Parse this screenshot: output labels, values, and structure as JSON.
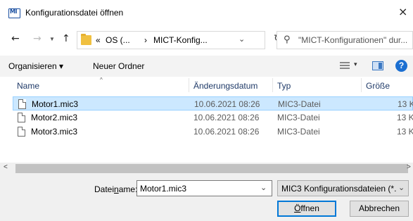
{
  "window": {
    "app_icon_text": "MI",
    "title": "Konfigurationsdatei öffnen",
    "close_glyph": "×"
  },
  "nav": {
    "back_glyph": "←",
    "forward_glyph": "→",
    "recent_glyph": "⌄",
    "up_glyph": "↑",
    "breadcrumb": [
      "«",
      "OS (...",
      "›",
      "MICT-Konfig..."
    ],
    "address_dropdown_glyph": "⌄",
    "refresh_glyph": "↻",
    "search_icon": "search-icon",
    "search_placeholder": "\"MICT-Konfigurationen\" dur..."
  },
  "toolbar": {
    "organize_label": "Organisieren ▾",
    "new_folder_label": "Neuer Ordner",
    "view_dropdown_glyph": "▾",
    "help_glyph": "?"
  },
  "columns": {
    "name": "Name",
    "date": "Änderungsdatum",
    "type": "Typ",
    "size": "Größe",
    "sort_indicator": "^"
  },
  "files": [
    {
      "name": "Motor1.mic3",
      "date": "10.06.2021 08:26",
      "type": "MIC3-Datei",
      "size": "13 K",
      "selected": true
    },
    {
      "name": "Motor2.mic3",
      "date": "10.06.2021 08:26",
      "type": "MIC3-Datei",
      "size": "13 K",
      "selected": false
    },
    {
      "name": "Motor3.mic3",
      "date": "10.06.2021 08:26",
      "type": "MIC3-Datei",
      "size": "13 K",
      "selected": false
    }
  ],
  "scrollbar": {
    "left_glyph": "<",
    "right_glyph": ">"
  },
  "footer": {
    "filename_label_pre": "Datei",
    "filename_label_u": "n",
    "filename_label_post": "ame:",
    "filename_value": "Motor1.mic3",
    "filename_dropdown_glyph": "⌄",
    "filetype_value": "MIC3 Konfigurationsdateien (*.",
    "filetype_dropdown_glyph": "⌄",
    "open_u": "Ö",
    "open_rest": "ffnen",
    "cancel_label": "Abbrechen"
  },
  "colors": {
    "selection_bg": "#cce8ff",
    "selection_border": "#99d1ff",
    "primary_border": "#0078d7",
    "help_blue": "#1c6fd1",
    "folder_yellow": "#f0c040"
  }
}
